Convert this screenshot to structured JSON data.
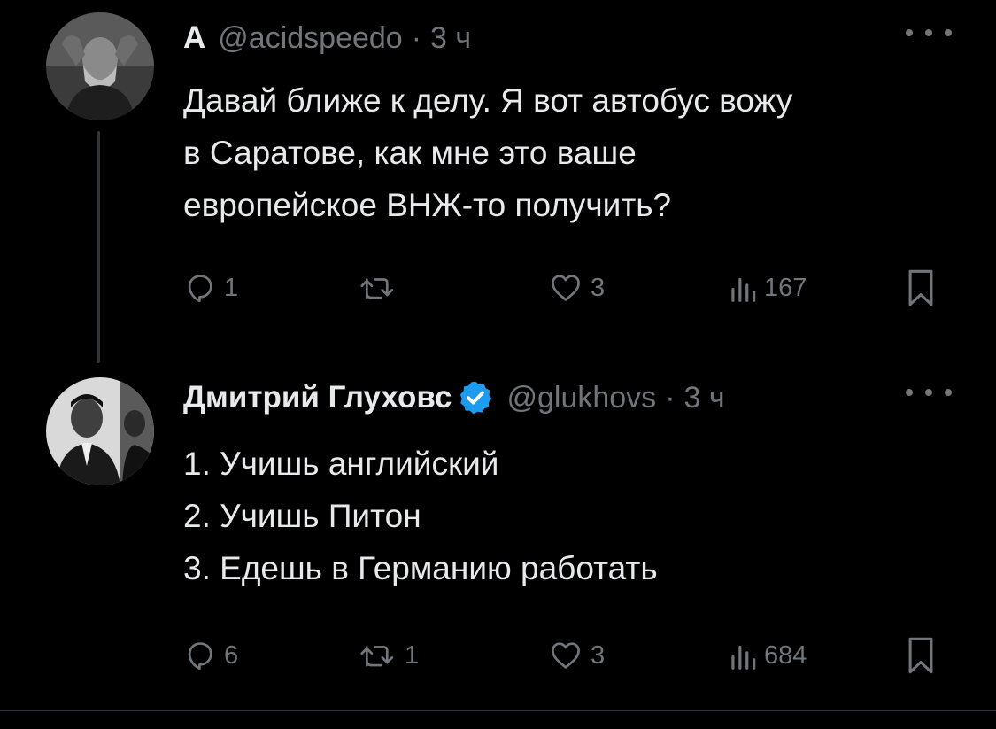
{
  "tweets": [
    {
      "display_name": "А",
      "handle": "@acidspeedo",
      "separator": "·",
      "time": "3 ч",
      "body_lines": [
        "Давай ближе к делу. Я вот автобус вожу",
        "в Саратове, как мне это ваше",
        "европейское ВНЖ-то получить?"
      ],
      "actions": {
        "replies": "1",
        "retweets": "",
        "likes": "3",
        "views": "167"
      }
    },
    {
      "display_name": "Дмитрий Глуховс",
      "verified": true,
      "handle": "@glukhovs",
      "separator": "·",
      "time": "3 ч",
      "body_lines": [
        "1. Учишь английский",
        "2. Учишь Питон",
        "3. Едешь в Германию работать"
      ],
      "actions": {
        "replies": "6",
        "retweets": "1",
        "likes": "3",
        "views": "684"
      }
    }
  ],
  "colors": {
    "background": "#000000",
    "text": "#e7e9ea",
    "secondary": "#71767b",
    "verified": "#1d9bf0"
  },
  "icons": [
    "more-icon",
    "reply-icon",
    "retweet-icon",
    "like-icon",
    "views-icon",
    "bookmark-icon",
    "verified-badge-icon"
  ]
}
